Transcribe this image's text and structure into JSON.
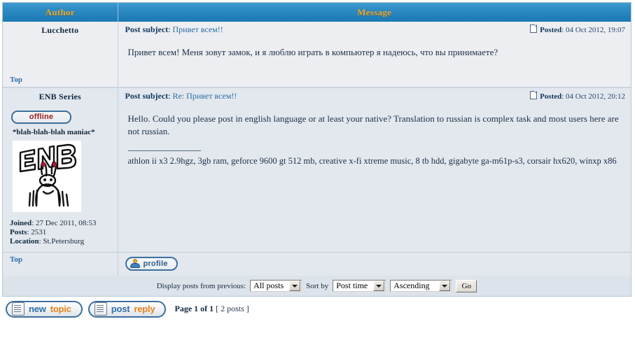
{
  "table": {
    "col_author": "Author",
    "col_message": "Message"
  },
  "labels": {
    "post_subject": "Post subject",
    "posted": "Posted",
    "top": "Top",
    "joined": "Joined",
    "posts": "Posts",
    "location": "Location",
    "profile": "profile"
  },
  "posts": [
    {
      "author": "Lucchetto",
      "subject_prefix": "",
      "subject": "Привет всем!!",
      "posted_date": "04 Oct 2012, 19:07",
      "body": "Привет всем! Меня зовут замок, и я люблю играть в компьютер я надеюсь, что вы принимаете?"
    },
    {
      "author": "ENB Series",
      "status": "offline",
      "rank": "*blah-blah-blah maniac*",
      "avatar_alt": "ENB",
      "joined_value": "27 Dec 2011, 08:53",
      "posts_value": "2531",
      "location_value": "St.Petersburg",
      "subject_prefix": "Re: ",
      "subject": "Re: Привет всем!!",
      "posted_date": "04 Oct 2012, 20:12",
      "body": "Hello. Could you please post in english language or at least your native? Translation to russian is complex task and most users here are not russian.",
      "signature": "athlon ii x3 2.9hgz, 3gb ram, geforce 9600 gt 512 mb, creative x-fi xtreme music, 8 tb hdd, gigabyte ga-m61p-s3, corsair hx620, winxp x86"
    }
  ],
  "controls": {
    "display_label": "Display posts from previous:",
    "display_value": "All posts",
    "sortby_label": "Sort by",
    "sortby_value": "Post time",
    "order_value": "Ascending",
    "go_label": "Go"
  },
  "footer": {
    "new_topic_word1": "new",
    "new_topic_word2": "topic",
    "post_reply_word1": "post",
    "post_reply_word2": "reply",
    "page_of": "Page 1 of 1",
    "posts_count": "[ 2 posts ]"
  },
  "colors": {
    "header_blue": "#1a79b4",
    "header_orange": "#f5a623",
    "link_blue": "#2b6ca3",
    "offline_red": "#a02020",
    "btn_border": "#3d6f9e",
    "accent_orange": "#e8821a"
  }
}
